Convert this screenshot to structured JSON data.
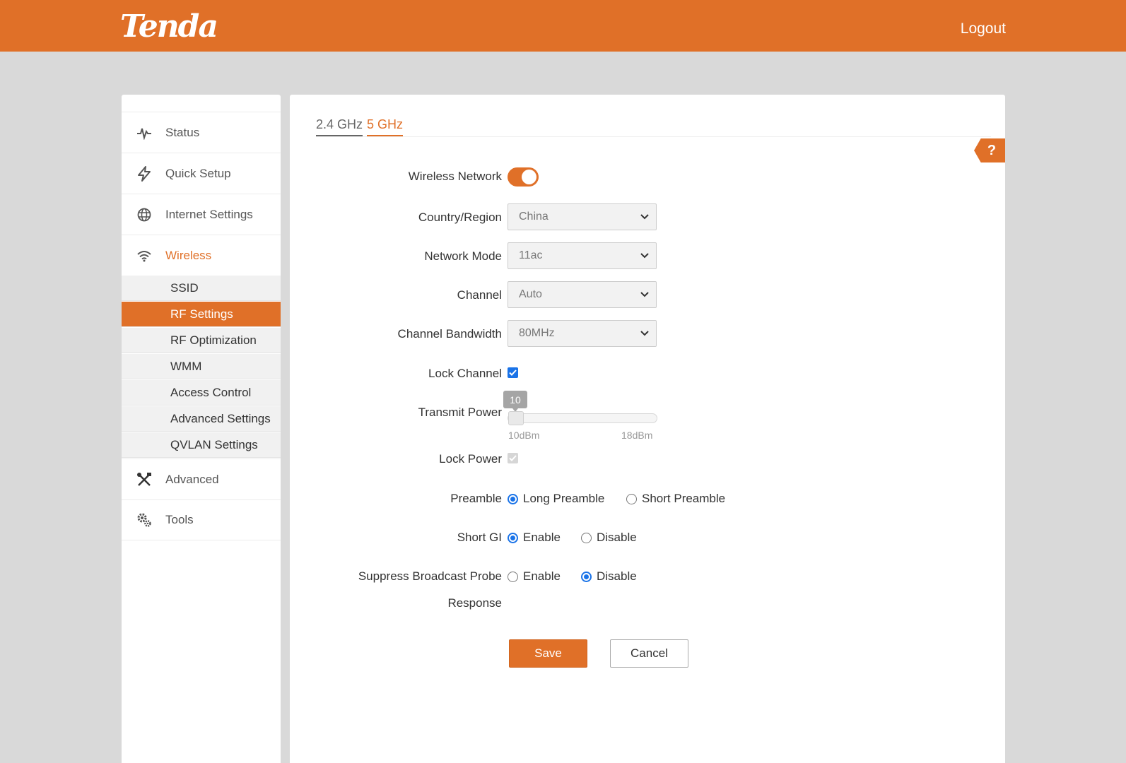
{
  "header": {
    "logo": "Tenda",
    "logout": "Logout"
  },
  "sidebar": {
    "items": [
      {
        "label": "Status",
        "icon": "pulse-icon"
      },
      {
        "label": "Quick Setup",
        "icon": "lightning-icon"
      },
      {
        "label": "Internet Settings",
        "icon": "globe-icon"
      },
      {
        "label": "Wireless",
        "icon": "wifi-icon",
        "active": true
      },
      {
        "label": "Advanced",
        "icon": "tools-icon"
      },
      {
        "label": "Tools",
        "icon": "gears-icon"
      }
    ],
    "wireless_sub": [
      "SSID",
      "RF Settings",
      "RF Optimization",
      "WMM",
      "Access Control",
      "Advanced Settings",
      "QVLAN Settings"
    ],
    "selected_sub": "RF Settings"
  },
  "tabs": [
    "2.4 GHz",
    "5 GHz"
  ],
  "active_tab": "5 GHz",
  "help_label": "?",
  "form": {
    "wireless_network": {
      "label": "Wireless Network",
      "enabled": true
    },
    "country": {
      "label": "Country/Region",
      "value": "China"
    },
    "network_mode": {
      "label": "Network Mode",
      "value": "11ac"
    },
    "channel": {
      "label": "Channel",
      "value": "Auto"
    },
    "bandwidth": {
      "label": "Channel Bandwidth",
      "value": "80MHz"
    },
    "lock_channel": {
      "label": "Lock Channel",
      "checked": true
    },
    "transmit_power": {
      "label": "Transmit Power",
      "value": "10",
      "min_label": "10dBm",
      "max_label": "18dBm"
    },
    "lock_power": {
      "label": "Lock Power",
      "checked": true,
      "disabled": true
    },
    "preamble": {
      "label": "Preamble",
      "options": [
        "Long Preamble",
        "Short Preamble"
      ],
      "selected": "Long Preamble"
    },
    "short_gi": {
      "label": "Short GI",
      "options": [
        "Enable",
        "Disable"
      ],
      "selected": "Enable"
    },
    "suppress": {
      "label_line1": "Suppress Broadcast Probe",
      "label_line2": "Response",
      "options": [
        "Enable",
        "Disable"
      ],
      "selected": "Disable"
    }
  },
  "buttons": {
    "save": "Save",
    "cancel": "Cancel"
  },
  "colors": {
    "brand": "#e07028",
    "accent": "#1a73e8"
  }
}
